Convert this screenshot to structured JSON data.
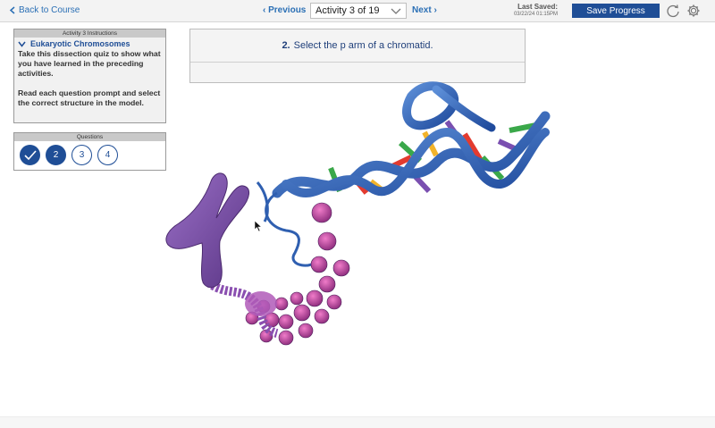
{
  "topbar": {
    "back_label": "Back to Course",
    "prev_label": "Previous",
    "activity_selected": "Activity 3 of 19",
    "next_label": "Next",
    "last_saved_label": "Last Saved:",
    "last_saved_time": "03/22/24 01:15PM",
    "save_label": "Save Progress"
  },
  "instructions": {
    "header": "Activity 3 Instructions",
    "title": "Eukaryotic Chromosomes",
    "paragraph1": "Take this dissection quiz to show what you have learned in the preceding activities.",
    "paragraph2": "Read each question prompt and select the correct structure in the model."
  },
  "questions": {
    "header": "Questions",
    "items": [
      {
        "label": "",
        "state": "completed"
      },
      {
        "label": "2",
        "state": "current"
      },
      {
        "label": "3",
        "state": "pending"
      },
      {
        "label": "4",
        "state": "pending"
      }
    ]
  },
  "prompt": {
    "number": "2.",
    "text": "Select the p arm of a chromatid."
  },
  "colors": {
    "accent": "#1f4e96",
    "link": "#2a6fb5",
    "dna_backbone": "#2f5fb0",
    "chromosome": "#7a4fa3",
    "nucleosome": "#c0409a"
  },
  "icons": [
    "chevron-left-icon",
    "chevron-down-icon",
    "reset-icon",
    "gear-icon",
    "checkmark-icon",
    "cursor-icon"
  ]
}
